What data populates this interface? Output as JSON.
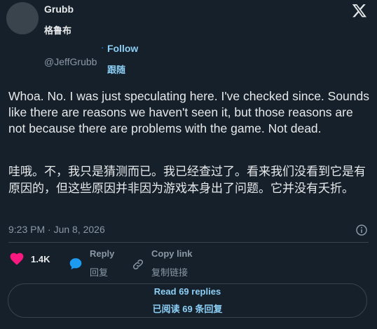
{
  "author": {
    "name": "Grubb",
    "name_zh": "格鲁布",
    "handle": "@JeffGrubb",
    "avatar_icon": "avatar-placeholder"
  },
  "follow": {
    "separator": "·",
    "label": "Follow",
    "label_zh": "跟随"
  },
  "post": {
    "text": "Whoa. No. I was just speculating here. I've checked since. Sounds like there are reasons we haven't seen it, but those reasons are not because there are problems with the game. Not dead.",
    "text_zh": "哇哦。不，我只是猜测而已。我已经查过了。看来我们没看到它是有原因的，但这些原因并非因为游戏本身出了问题。它并没有夭折。",
    "timestamp": "9:23 PM · Jun 8, 2026"
  },
  "actions": {
    "likes": "1.4K",
    "reply_label": "Reply",
    "reply_label_zh": "回复",
    "copy_link_label": "Copy link",
    "copy_link_label_zh": "复制链接"
  },
  "read_replies": {
    "label": "Read 69 replies",
    "label_zh": "已阅读 69 条回复"
  },
  "icons": {
    "logo": "x-logo-icon",
    "info": "info-icon",
    "like": "heart-icon",
    "reply": "reply-bubble-icon",
    "link": "link-icon"
  },
  "colors": {
    "background": "#15202b",
    "text": "#e7e9ea",
    "muted": "#8b98a5",
    "accent": "#1d9bf0",
    "link": "#8ccff5",
    "like": "#f91880"
  }
}
